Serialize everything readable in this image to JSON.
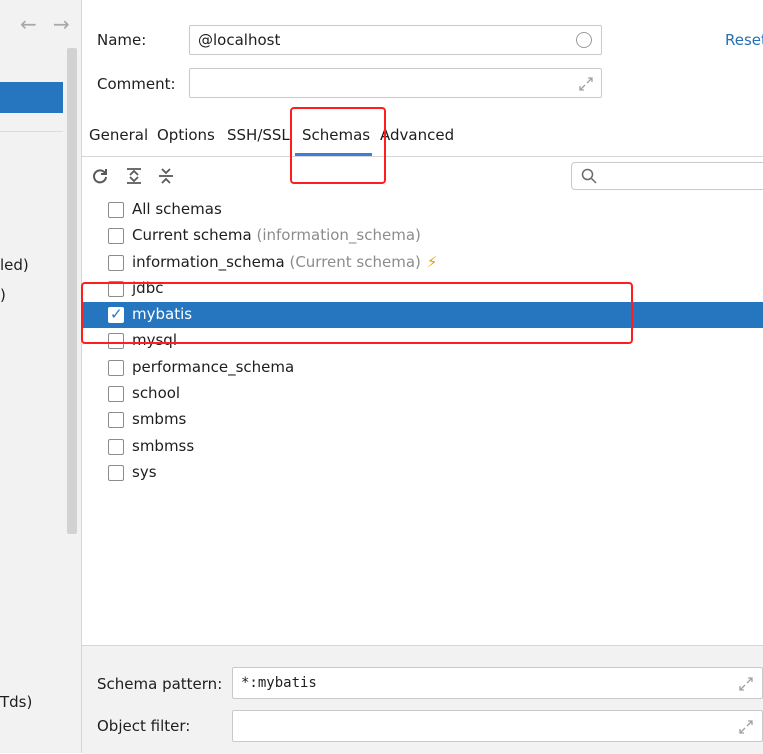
{
  "sidebar": {
    "back_arrow": "←",
    "forward_arrow": "→",
    "partial_items": [
      "led)",
      ")",
      "Tds)"
    ]
  },
  "form": {
    "name_label": "Name:",
    "name_value": "@localhost",
    "comment_label": "Comment:",
    "comment_value": "",
    "reset_label": "Reset"
  },
  "tabs": [
    "General",
    "Options",
    "SSH/SSL",
    "Schemas",
    "Advanced"
  ],
  "active_tab": "Schemas",
  "toolbar": {
    "icons": [
      "refresh-icon",
      "expand-all-icon",
      "collapse-all-icon",
      "search-icon"
    ],
    "search_value": ""
  },
  "schemas": [
    {
      "label": "All schemas",
      "hint": "",
      "checked": false
    },
    {
      "label": "Current schema",
      "hint": "(information_schema)",
      "checked": false
    },
    {
      "label": "information_schema",
      "hint": "(Current schema)",
      "checked": false
    },
    {
      "label": "jdbc",
      "hint": "",
      "checked": false
    },
    {
      "label": "mybatis",
      "hint": "",
      "checked": true
    },
    {
      "label": "mysql",
      "hint": "",
      "checked": false
    },
    {
      "label": "performance_schema",
      "hint": "",
      "checked": false
    },
    {
      "label": "school",
      "hint": "",
      "checked": false
    },
    {
      "label": "smbms",
      "hint": "",
      "checked": false
    },
    {
      "label": "smbmss",
      "hint": "",
      "checked": false
    },
    {
      "label": "sys",
      "hint": "",
      "checked": false
    }
  ],
  "bottom": {
    "schema_pattern_label": "Schema pattern:",
    "schema_pattern_value": "*:mybatis",
    "object_filter_label": "Object filter:",
    "object_filter_value": ""
  },
  "colors": {
    "selection": "#2675bf",
    "annotation": "#ff1e1e",
    "link": "#2470b3"
  }
}
